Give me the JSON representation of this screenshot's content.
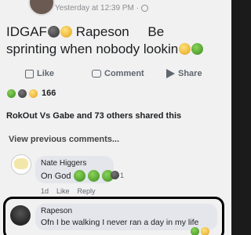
{
  "post": {
    "time": "Yesterday at 12:39 PM ·",
    "text_line1": "IDGAF",
    "text_name": "Rapeson",
    "text_be": "Be",
    "text_line2": "sprinting when nobody lookin"
  },
  "actions": {
    "like": "Like",
    "comment": "Comment",
    "share": "Share"
  },
  "reactions": {
    "count": "166"
  },
  "shares": {
    "text": "RokOut Vs Gabe and 73 others shared this"
  },
  "comments": {
    "view_previous": "View previous comments...",
    "items": [
      {
        "name": "Nate Higgers",
        "text": "On God",
        "reaction_count": "1",
        "time": "1d",
        "like": "Like",
        "reply": "Reply"
      },
      {
        "name": "Rapeson",
        "text": "Ofn I be walking I never ran a day in my life"
      }
    ]
  },
  "colors": {
    "text": "#1c1e21",
    "secondary": "#606770",
    "bubble": "#e4e6eb",
    "background": "#f1f1f1"
  }
}
